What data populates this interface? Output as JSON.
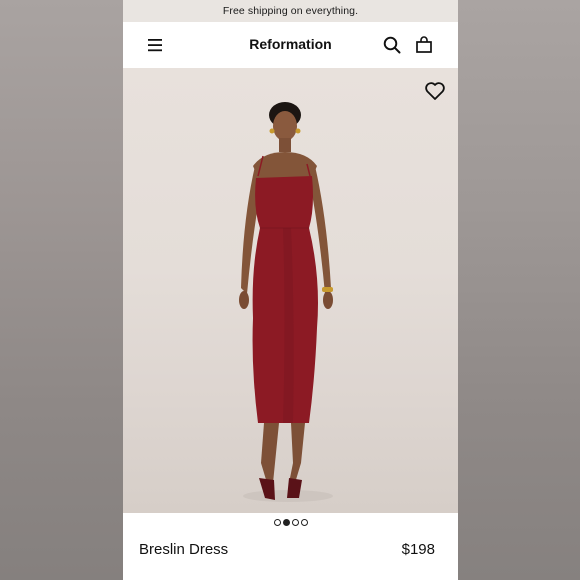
{
  "promo_banner": {
    "text": "Free shipping on everything."
  },
  "header": {
    "brand": "Reformation",
    "menu_icon": "hamburger-menu-icon",
    "search_icon": "search-icon",
    "bag_icon": "shopping-bag-icon"
  },
  "product_image": {
    "description_icon": "heart-icon",
    "carousel": {
      "total": 4,
      "active_index": 1
    }
  },
  "product": {
    "name": "Breslin Dress",
    "price": "$198"
  },
  "colors": {
    "dress": "#8c1a24",
    "background": "#e6dfda",
    "promo_bg": "#e9e5e1"
  }
}
